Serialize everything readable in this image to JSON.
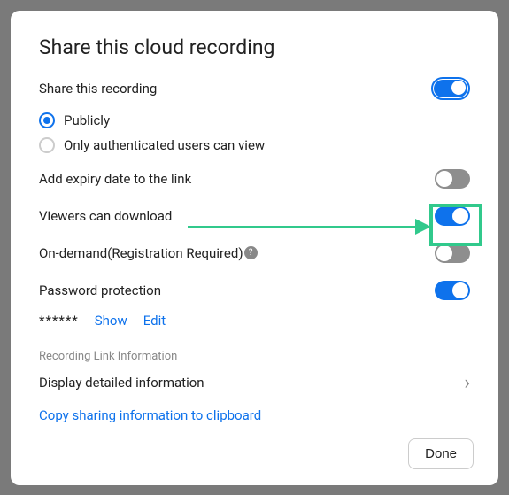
{
  "title": "Share this cloud recording",
  "share_recording": {
    "label": "Share this recording",
    "enabled": true
  },
  "radio": {
    "publicly": "Publicly",
    "authenticated": "Only authenticated users can view",
    "selected": "publicly"
  },
  "expiry": {
    "label": "Add expiry date to the link",
    "enabled": false
  },
  "download": {
    "label": "Viewers can download",
    "enabled": true
  },
  "on_demand": {
    "label": "On-demand(Registration Required)",
    "enabled": false
  },
  "password": {
    "label": "Password protection",
    "enabled": true,
    "masked": "******",
    "show": "Show",
    "edit": "Edit"
  },
  "link_info_section": "Recording Link Information",
  "display_detailed": "Display detailed information",
  "copy_clipboard": "Copy sharing information to clipboard",
  "done": "Done"
}
